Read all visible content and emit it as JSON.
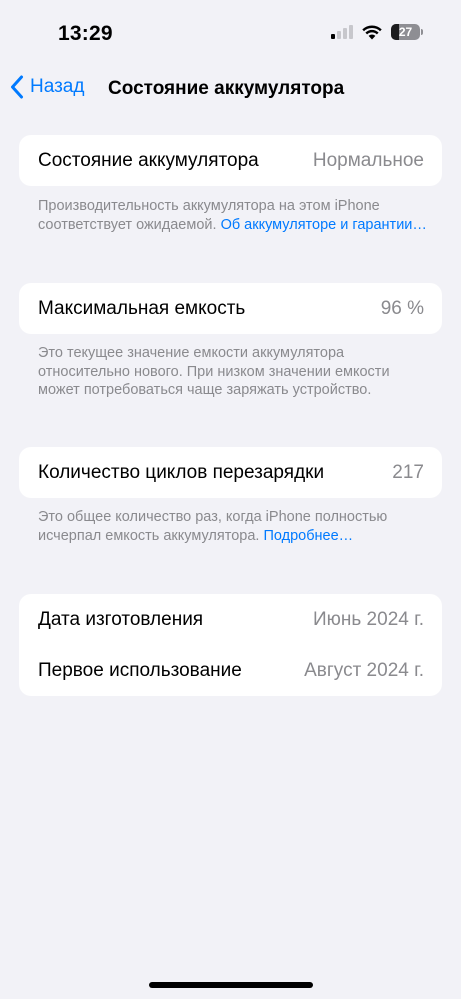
{
  "status_bar": {
    "time": "13:29",
    "battery_level": "27",
    "signal_bars_active": 1,
    "signal_bars_total": 4
  },
  "nav": {
    "back_label": "Назад",
    "title": "Состояние аккумулятора"
  },
  "health": {
    "label": "Состояние аккумулятора",
    "value": "Нормальное",
    "footnote_text": "Производительность аккумулятора на этом iPhone соответствует ожидаемой. ",
    "footnote_link": "Об аккумуляторе и гарантии…"
  },
  "capacity": {
    "label": "Максимальная емкость",
    "value": "96 %",
    "footnote_text": "Это текущее значение емкости аккумулятора относительно нового. При низком значении емкости может потребоваться чаще заряжать устройство."
  },
  "cycles": {
    "label": "Количество циклов перезарядки",
    "value": "217",
    "footnote_text": "Это общее количество раз, когда iPhone полностью исчерпал емкость аккумулятора. ",
    "footnote_link": "Подробнее…"
  },
  "dates": {
    "manufacture_label": "Дата изготовления",
    "manufacture_value": "Июнь 2024 г.",
    "first_use_label": "Первое использование",
    "first_use_value": "Август 2024 г."
  },
  "colors": {
    "accent": "#007aff",
    "background": "#f2f2f7",
    "secondary_text": "#8a8a8e"
  }
}
